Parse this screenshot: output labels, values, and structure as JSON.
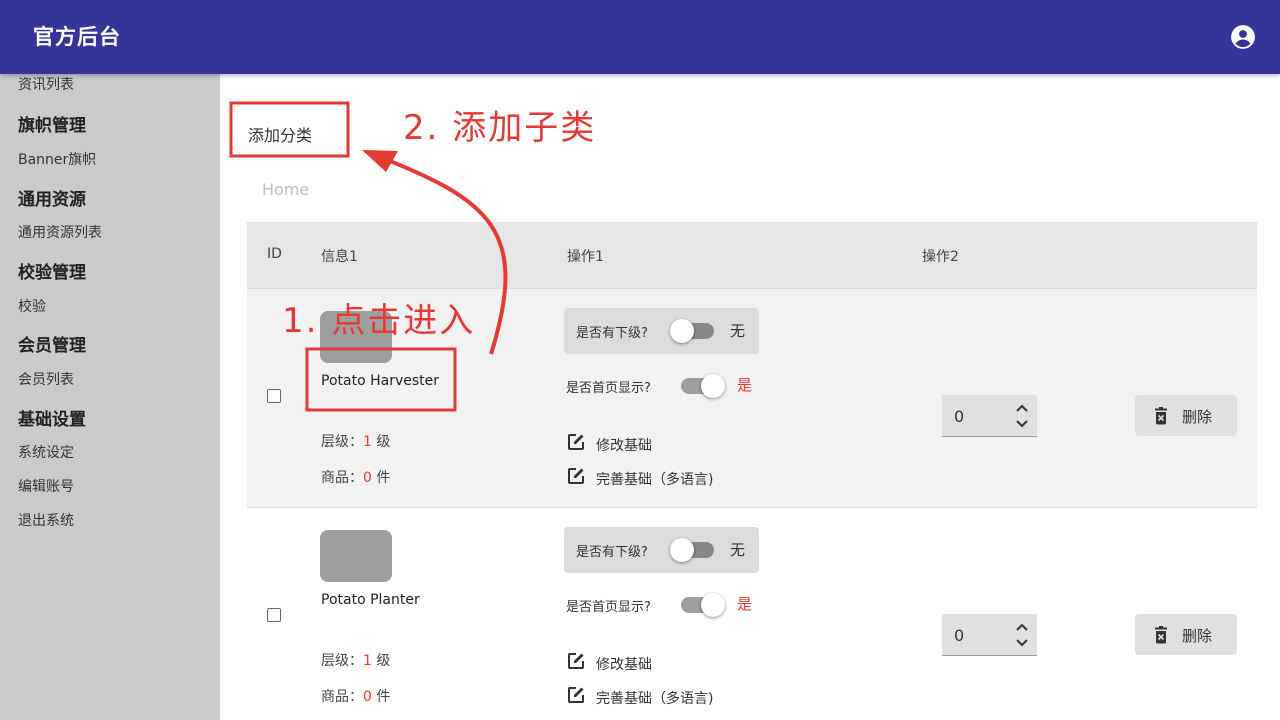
{
  "header": {
    "title": "官方后台",
    "account_icon": "account-circle-icon"
  },
  "sidebar": {
    "items": [
      {
        "label": "资讯列表",
        "type": "item"
      },
      {
        "label": "旗帜管理",
        "type": "group"
      },
      {
        "label": "Banner旗帜",
        "type": "item"
      },
      {
        "label": "通用资源",
        "type": "group"
      },
      {
        "label": "通用资源列表",
        "type": "item"
      },
      {
        "label": "校验管理",
        "type": "group"
      },
      {
        "label": "校验",
        "type": "item"
      },
      {
        "label": "会员管理",
        "type": "group"
      },
      {
        "label": "会员列表",
        "type": "item"
      },
      {
        "label": "基础设置",
        "type": "group"
      },
      {
        "label": "系统设定",
        "type": "item"
      },
      {
        "label": "编辑账号",
        "type": "item"
      },
      {
        "label": "退出系统",
        "type": "item"
      }
    ]
  },
  "main": {
    "add_category": "添加分类",
    "breadcrumb": "Home",
    "table": {
      "headers": [
        "ID",
        "信息1",
        "操作1",
        "操作2"
      ],
      "rows": [
        {
          "name": "Potato Harvester",
          "level_label": "层级：",
          "level_value": "1",
          "level_unit": " 级",
          "goods_label": "商品：",
          "goods_value": "0",
          "goods_unit": " 件",
          "has_children_label": "是否有下级?",
          "has_children_state": "无",
          "home_display_label": "是否首页显示?",
          "home_display_state": "是",
          "edit_basic": "修改基础",
          "complete_basic": "完善基础（多语言)",
          "order_value": "0",
          "delete_label": "删除"
        },
        {
          "name": "Potato Planter",
          "level_label": "层级：",
          "level_value": "1",
          "level_unit": " 级",
          "goods_label": "商品：",
          "goods_value": "0",
          "goods_unit": " 件",
          "has_children_label": "是否有下级?",
          "has_children_state": "无",
          "home_display_label": "是否首页显示?",
          "home_display_state": "是",
          "edit_basic": "修改基础",
          "complete_basic": "完善基础（多语言)",
          "order_value": "0",
          "delete_label": "删除"
        }
      ]
    }
  },
  "annotations": {
    "step1": "1. 点击进入",
    "step2": "2. 添加子类",
    "color": "#e53935"
  },
  "colors": {
    "appbar": "#353599",
    "sidebar": "#cacaca",
    "accent_red": "#e53935"
  }
}
